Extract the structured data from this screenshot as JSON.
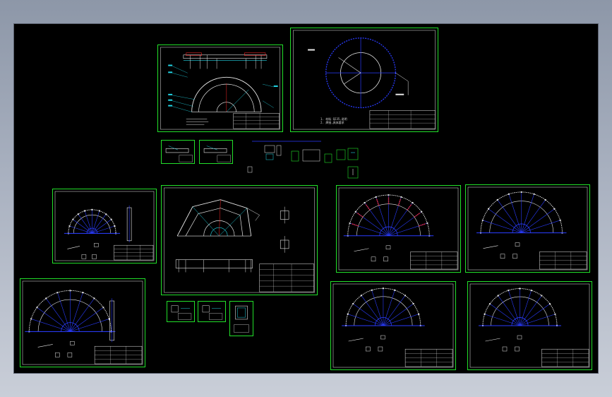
{
  "viewer": {
    "background_color": "#000000",
    "frame_color": "#22e02a",
    "accent_blue": "#2a3cff",
    "accent_cyan": "#22d8e8",
    "accent_red": "#ff2a2a",
    "accent_white": "#e8e8e8"
  },
  "sheets": [
    {
      "id": "sheet-top-left-plan",
      "kind": "arch-plan"
    },
    {
      "id": "sheet-top-right-circle",
      "kind": "circle-plan"
    },
    {
      "id": "sheet-mid-left-small-arch",
      "kind": "fan-arch"
    },
    {
      "id": "sheet-center-polygon",
      "kind": "polygon-plan"
    },
    {
      "id": "sheet-mid-right-red-arch",
      "kind": "fan-arch-red"
    },
    {
      "id": "sheet-mid-far-right-arch",
      "kind": "fan-arch"
    },
    {
      "id": "sheet-bottom-left-arch",
      "kind": "fan-arch-large"
    },
    {
      "id": "sheet-bottom-right-arch-1",
      "kind": "fan-arch"
    },
    {
      "id": "sheet-bottom-right-arch-2",
      "kind": "fan-arch"
    }
  ],
  "annotations": {
    "circle_note_line1": "1. 材料 Q235,说明",
    "circle_note_line2": "2. 焊接,具体要求"
  }
}
